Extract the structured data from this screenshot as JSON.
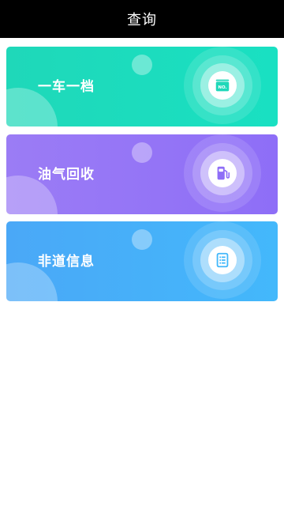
{
  "header": {
    "title": "查询"
  },
  "cards": [
    {
      "label": "一车一档",
      "icon": "id-card-icon",
      "accent": "#1fd8b9"
    },
    {
      "label": "油气回收",
      "icon": "fuel-pump-icon",
      "accent": "#8e6ef7"
    },
    {
      "label": "非道信息",
      "icon": "document-list-icon",
      "accent": "#43b8fb"
    }
  ],
  "icons": {
    "no_badge_text": "NO."
  }
}
